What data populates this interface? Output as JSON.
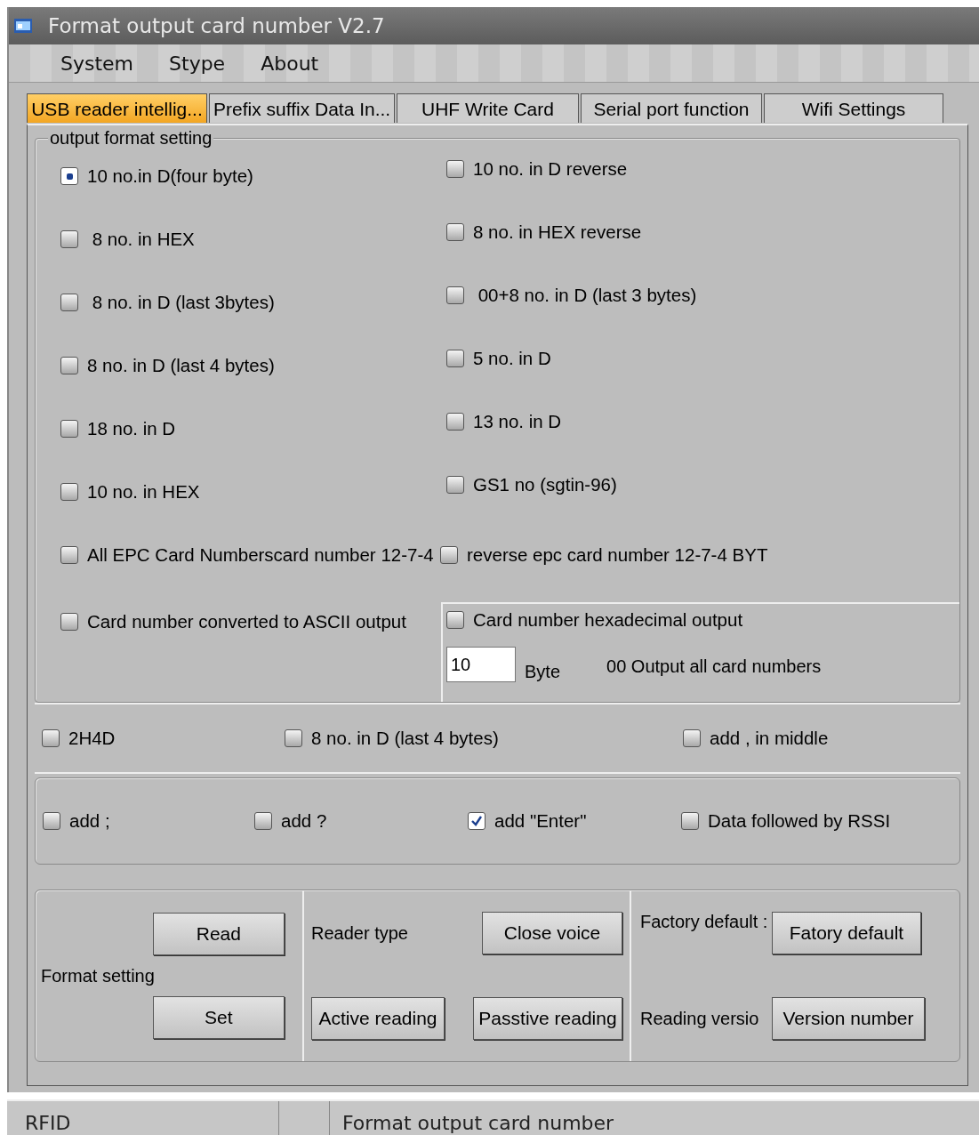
{
  "window": {
    "title": "Format output  card number V2.7"
  },
  "menu": [
    "System",
    "Stype",
    "About"
  ],
  "tabs": [
    {
      "label": "USB reader intellig...",
      "selected": true
    },
    {
      "label": "Prefix suffix Data In...",
      "selected": false
    },
    {
      "label": "UHF Write Card",
      "selected": false
    },
    {
      "label": "Serial port function",
      "selected": false
    },
    {
      "label": "Wifi Settings",
      "selected": false
    }
  ],
  "output_format": {
    "title": "output format setting",
    "options": [
      {
        "label": "10 no.in D(four byte)",
        "checked": true
      },
      {
        "label": "10 no. in D reverse",
        "checked": false
      },
      {
        "label": " 8 no. in HEX",
        "checked": false
      },
      {
        "label": "8 no. in HEX reverse",
        "checked": false
      },
      {
        "label": " 8 no. in D (last 3bytes)",
        "checked": false
      },
      {
        "label": " 00+8 no. in D (last 3 bytes)",
        "checked": false
      },
      {
        "label": "8 no. in D (last 4 bytes)",
        "checked": false
      },
      {
        "label": "5 no. in D",
        "checked": false
      },
      {
        "label": "18 no. in D",
        "checked": false
      },
      {
        "label": "13 no. in D",
        "checked": false
      },
      {
        "label": "10 no. in HEX",
        "checked": false
      },
      {
        "label": "GS1 no (sgtin-96)",
        "checked": false
      },
      {
        "label": "All EPC Card Numberscard number 12-7-4",
        "checked": false
      },
      {
        "label": "reverse epc card number 12-7-4 BYT",
        "checked": false
      },
      {
        "label": "Card number converted to ASCII output",
        "checked": false
      }
    ],
    "hex_output": {
      "label": "Card number hexadecimal output",
      "checked": false,
      "value": "10",
      "unit": "Byte",
      "note": "00 Output all card numbers"
    }
  },
  "extra_options": [
    {
      "label": "2H4D",
      "checked": false
    },
    {
      "label": "8 no. in D (last 4 bytes)",
      "checked": false
    },
    {
      "label": "add , in middle",
      "checked": false
    }
  ],
  "suffix_options": [
    {
      "label": "add ;",
      "checked": false
    },
    {
      "label": "add ?",
      "checked": false
    },
    {
      "label": "add \"Enter\"",
      "checked": true
    },
    {
      "label": "Data followed by RSSI",
      "checked": false
    }
  ],
  "format_panel": {
    "label": "Format setting",
    "buttons": [
      "Read",
      "Set"
    ]
  },
  "reader_panel": {
    "label": "Reader type",
    "buttons": [
      "Close voice",
      "Active reading",
      "Passtive reading"
    ]
  },
  "factory_panel": {
    "factory_label": "Factory default :",
    "factory_button": "Fatory default",
    "version_label": "Reading versio",
    "version_button": "Version number"
  },
  "status_bar": {
    "left": "RFID",
    "right": "Format output  card number"
  }
}
